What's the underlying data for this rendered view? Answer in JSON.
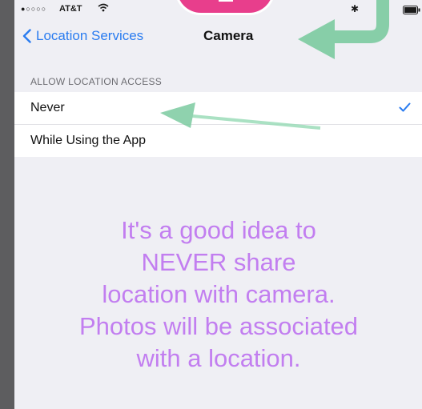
{
  "status_bar": {
    "signal": "●○○○○",
    "carrier": "AT&T"
  },
  "nav": {
    "back_label": "Location Services",
    "title": "Camera"
  },
  "section": {
    "header": "ALLOW LOCATION ACCESS",
    "options": [
      {
        "label": "Never",
        "selected": true
      },
      {
        "label": "While Using the App",
        "selected": false
      }
    ]
  },
  "caption": {
    "text": "It's a good idea to\nNEVER share\nlocation with camera.\nPhotos will be associated\nwith a location."
  },
  "colors": {
    "ios_blue": "#2a7cf0",
    "caption_purple": "#c27ef0",
    "arrow_green": "#7ccba0",
    "badge_pink": "#e83e8c"
  },
  "icons": [
    "wifi-icon",
    "bluetooth-icon",
    "battery-icon",
    "chevron-left-icon",
    "checkmark-icon",
    "lock-icon",
    "arrow-icon"
  ]
}
